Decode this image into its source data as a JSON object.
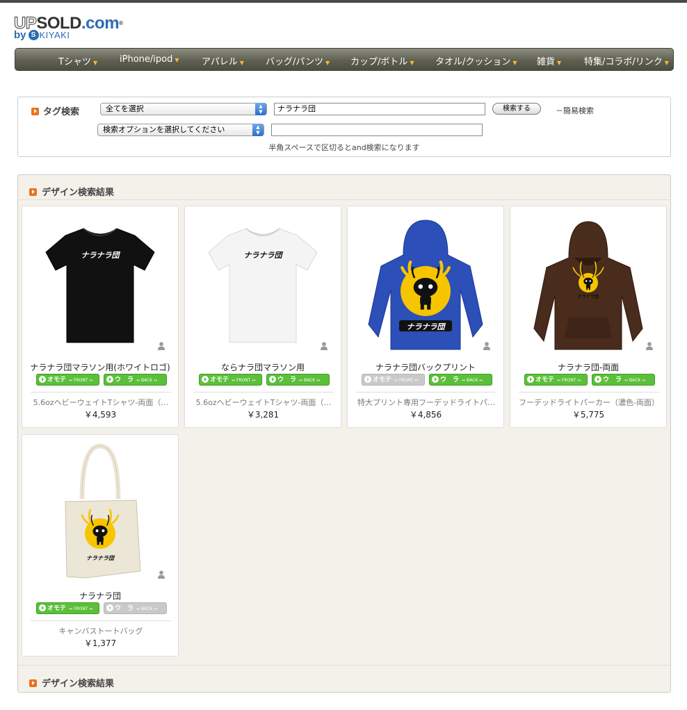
{
  "logo": {
    "up": "UP",
    "sold": "SOLD",
    "com": ".com",
    "reg": "®",
    "by": "by",
    "s": "S",
    "kiyaki": "KIYAKI"
  },
  "nav": {
    "items": [
      {
        "label": "Tシャツ"
      },
      {
        "label": "iPhone/ipod"
      },
      {
        "label": "アパレル"
      },
      {
        "label": "バッグ/パンツ"
      },
      {
        "label": "カップ/ボトル"
      },
      {
        "label": "タオル/クッション"
      },
      {
        "label": "雑貨"
      },
      {
        "label": "特集/コラボ/リンク"
      }
    ],
    "arrow": "▼"
  },
  "search": {
    "label": "タグ検索",
    "category_select": "全てを選択",
    "query": "ナラナラ団",
    "button": "検索する",
    "simple_link": "－簡易検索",
    "option_select": "検索オプションを選択してください",
    "option_input": "",
    "note": "半角スペースで区切るとand検索になります"
  },
  "results": {
    "title": "デザイン検索結果",
    "footer_title": "デザイン検索結果",
    "front_label": "オモテ",
    "front_small": "↔ FRONT ↔",
    "back_label": "ウ　ラ",
    "back_small": "↔ BACK ↔",
    "items": [
      {
        "name": "ナラナラ団マラソン用(ホワイトロゴ)",
        "product": "5.6ozヘビーウェイトTシャツ-両面（…",
        "price": "￥4,593",
        "front_active": true,
        "back_active": true,
        "item_color": "#111111",
        "type": "tshirt",
        "print_text": "ナラナラ団"
      },
      {
        "name": "ならナラ団マラソン用",
        "product": "5.6ozヘビーウェイトTシャツ-両面（…",
        "price": "￥3,281",
        "front_active": true,
        "back_active": true,
        "item_color": "#f4f4f4",
        "type": "tshirt",
        "print_text": "ナラナラ団"
      },
      {
        "name": "ナラナラ団バックプリント",
        "product": "特大プリント専用フーデッドライトパ…",
        "price": "￥4,856",
        "front_active": false,
        "back_active": true,
        "item_color": "#2c4fb8",
        "type": "hoodie-back",
        "print_text": "ナラナラ団"
      },
      {
        "name": "ナラナラ団-両面",
        "product": "フーデッドライトパーカー（濃色-両面）",
        "price": "￥5,775",
        "front_active": true,
        "back_active": true,
        "item_color": "#4a2c1c",
        "type": "hoodie-front",
        "print_text": "ナラナラ団"
      },
      {
        "name": "ナラナラ団",
        "product": "キャンバストートバッグ",
        "price": "￥1,377",
        "front_active": true,
        "back_active": false,
        "item_color": "#ece6d6",
        "type": "tote",
        "print_text": "ナラナラ団"
      }
    ]
  }
}
